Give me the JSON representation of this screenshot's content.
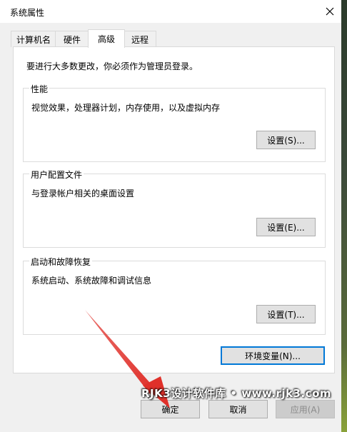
{
  "window": {
    "title": "系统属性"
  },
  "tabs": [
    {
      "label": "计算机名"
    },
    {
      "label": "硬件"
    },
    {
      "label": "高级"
    },
    {
      "label": "远程"
    }
  ],
  "advanced": {
    "intro": "要进行大多数更改，你必须作为管理员登录。",
    "performance": {
      "title": "性能",
      "description": "视觉效果，处理器计划，内存使用，以及虚拟内存",
      "button": "设置(S)..."
    },
    "user_profiles": {
      "title": "用户配置文件",
      "description": "与登录帐户相关的桌面设置",
      "button": "设置(E)..."
    },
    "startup_recovery": {
      "title": "启动和故障恢复",
      "description": "系统启动、系统故障和调试信息",
      "button": "设置(T)..."
    },
    "env_button": "环境变量(N)..."
  },
  "footer": {
    "ok": "确定",
    "cancel": "取消",
    "apply": "应用(A)"
  },
  "watermark": "RJK3设计软件库 • www.rjk3.com",
  "colors": {
    "accent": "#0078d7",
    "annotation_arrow": "#e0302a"
  }
}
